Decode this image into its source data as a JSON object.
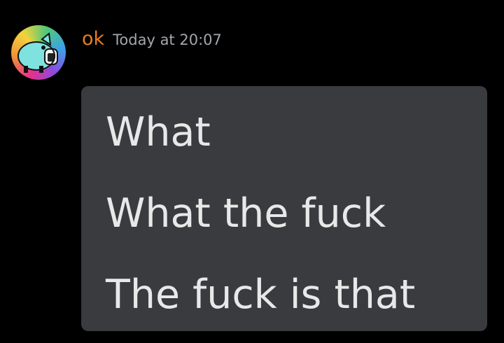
{
  "message": {
    "author": "ok",
    "timestamp": "Today at 20:07",
    "author_color": "#e67e22",
    "avatar_icon": "pig-avatar-icon",
    "lines": [
      "What",
      "What the fuck",
      "The fuck is that"
    ]
  }
}
